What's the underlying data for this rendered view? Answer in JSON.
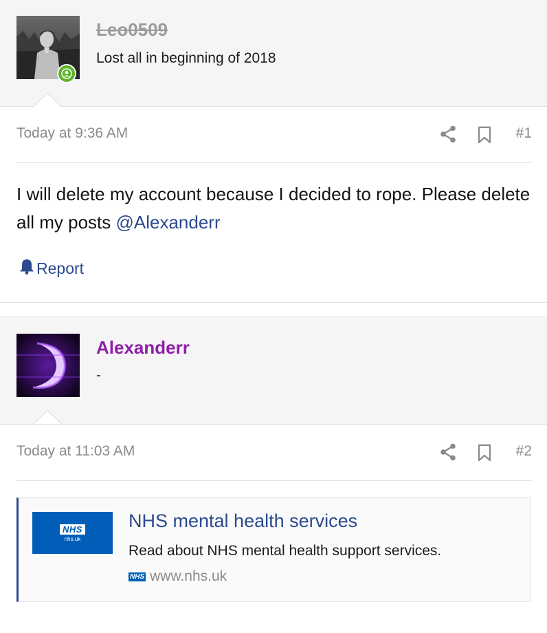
{
  "posts": [
    {
      "author": {
        "username": "Leo0509",
        "title": "Lost all in beginning of 2018",
        "online": true
      },
      "date": "Today at 9:36 AM",
      "number": "#1",
      "body_text": "I will delete my account because I decided to rope. Please delete all my posts ",
      "mention": "@Alexanderr",
      "report_label": "Report"
    },
    {
      "author": {
        "username": "Alexanderr",
        "title": "-"
      },
      "date": "Today at 11:03 AM",
      "number": "#2",
      "link_card": {
        "logo_text": "NHS",
        "logo_subtext": "nhs.uk",
        "title": "NHS mental health services",
        "description": "Read about NHS mental health support services.",
        "domain_badge": "NHS",
        "domain": "www.nhs.uk"
      }
    }
  ],
  "icons": {
    "share": "share-icon",
    "bookmark": "bookmark-icon",
    "report": "bell-icon",
    "online": "user-online-icon"
  },
  "colors": {
    "link": "#2b4a8f",
    "username_second": "#8e1fa8",
    "online": "#5fb32a",
    "nhs_blue": "#005eb8"
  }
}
